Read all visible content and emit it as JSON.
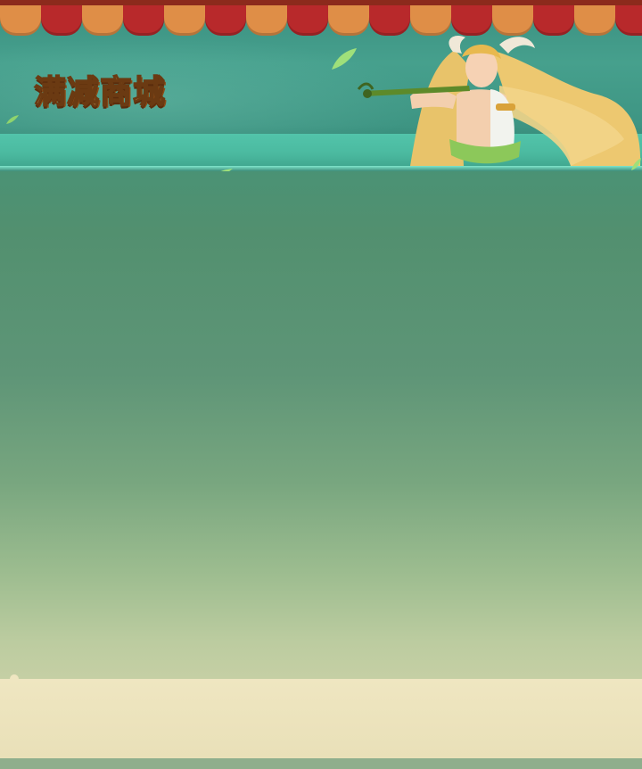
{
  "header": {
    "title": "满减商城",
    "colors": {
      "awning_red": "#b8292b",
      "awning_orange": "#df8e47",
      "banner_teal": "#46a08d",
      "title_gold": "#f7d07c"
    },
    "character_icon": "flute-player-character"
  },
  "content": {
    "background_top": "#4a9275",
    "background_bottom": "#c5cfa4"
  },
  "footer": {
    "panel_color": "#efe6c1"
  }
}
